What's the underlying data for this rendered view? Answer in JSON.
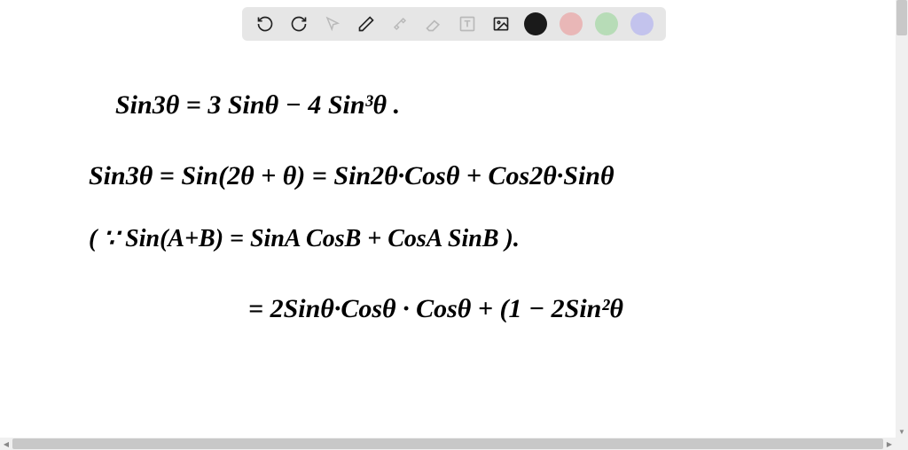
{
  "toolbar": {
    "colors": {
      "black": "#1a1a1a",
      "pink": "#e9b7b7",
      "green": "#b7dcb7",
      "purple": "#c3c3ed"
    }
  },
  "handwriting": {
    "line1": "Sin3θ  =  3 Sinθ − 4 Sin³θ .",
    "line2": "Sin3θ  =   Sin(2θ + θ)   =   Sin2θ·Cosθ  +  Cos2θ·Sinθ",
    "line3": "( ∵ Sin(A+B) = SinA CosB + CosA SinB ).",
    "line4": "=  2Sinθ·Cosθ · Cosθ   +   (1 − 2Sin²θ"
  }
}
